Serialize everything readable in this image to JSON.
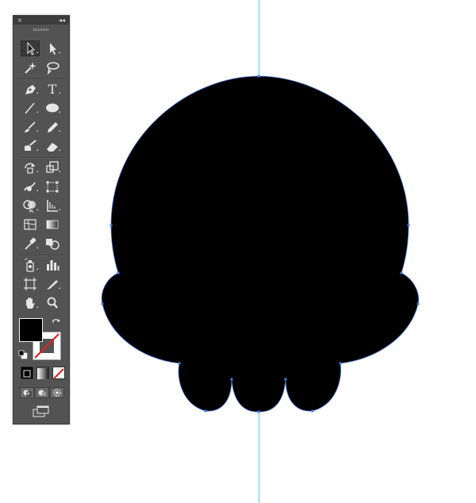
{
  "panel": {
    "close_glyph": "×",
    "collapse_glyph": "◂◂"
  },
  "tools": [
    {
      "id": "selection",
      "icon": "selection-arrow-icon",
      "selected": true
    },
    {
      "id": "direct-selection",
      "icon": "direct-selection-arrow-icon"
    },
    {
      "id": "magic-wand",
      "icon": "magic-wand-icon"
    },
    {
      "id": "lasso",
      "icon": "lasso-icon"
    },
    {
      "id": "pen",
      "icon": "pen-icon"
    },
    {
      "id": "type",
      "icon": "type-icon",
      "glyph": "T"
    },
    {
      "id": "line-segment",
      "icon": "line-segment-icon"
    },
    {
      "id": "ellipse",
      "icon": "ellipse-icon"
    },
    {
      "id": "paintbrush",
      "icon": "paintbrush-icon"
    },
    {
      "id": "pencil",
      "icon": "pencil-icon"
    },
    {
      "id": "blob-brush",
      "icon": "blob-brush-icon"
    },
    {
      "id": "eraser",
      "icon": "eraser-icon"
    },
    {
      "id": "rotate",
      "icon": "rotate-icon"
    },
    {
      "id": "scale",
      "icon": "scale-icon"
    },
    {
      "id": "warp",
      "icon": "warp-icon"
    },
    {
      "id": "free-transform",
      "icon": "free-transform-icon"
    },
    {
      "id": "shape-builder",
      "icon": "shape-builder-icon"
    },
    {
      "id": "perspective-grid",
      "icon": "perspective-grid-icon"
    },
    {
      "id": "mesh",
      "icon": "mesh-icon"
    },
    {
      "id": "gradient",
      "icon": "gradient-icon"
    },
    {
      "id": "eyedropper",
      "icon": "eyedropper-icon"
    },
    {
      "id": "blend",
      "icon": "blend-icon"
    },
    {
      "id": "symbol-sprayer",
      "icon": "symbol-sprayer-icon"
    },
    {
      "id": "column-graph",
      "icon": "column-graph-icon"
    },
    {
      "id": "artboard",
      "icon": "artboard-icon"
    },
    {
      "id": "slice",
      "icon": "slice-icon"
    },
    {
      "id": "hand",
      "icon": "hand-icon"
    },
    {
      "id": "zoom",
      "icon": "zoom-icon"
    }
  ],
  "colors": {
    "fill": "#000000",
    "stroke": "none",
    "guide": "#4fd3ea",
    "anchor": "#4a7bd8",
    "panel_bg": "#535353"
  },
  "color_modes": [
    "color-icon",
    "gradient-icon",
    "none-icon"
  ],
  "drawing_modes": [
    "draw-normal-icon",
    "draw-behind-icon",
    "draw-inside-icon"
  ],
  "screen_mode": "change-screen-mode-icon"
}
